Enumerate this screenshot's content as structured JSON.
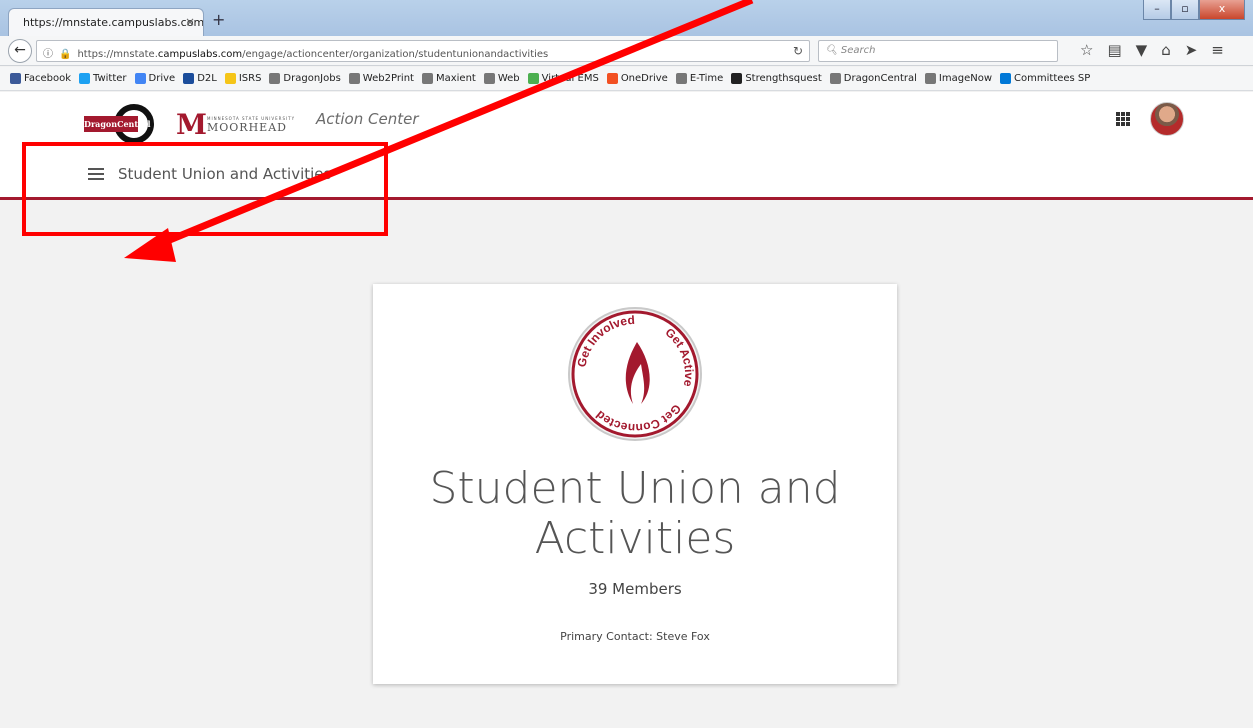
{
  "browser": {
    "tab_title": "https://mnstate.campuslabs.com",
    "tab_close": "×",
    "new_tab": "+",
    "url_prefix": "https://mnstate.",
    "url_host": "campuslabs.com",
    "url_path": "/engage/actioncenter/organization/studentunionandactivities",
    "search_placeholder": "Search",
    "window_buttons": [
      "–",
      "▫",
      "x"
    ]
  },
  "bookmarks": [
    {
      "label": "Facebook",
      "color": "#3b5998"
    },
    {
      "label": "Twitter",
      "color": "#1da1f2"
    },
    {
      "label": "Drive",
      "color": "#4285f4"
    },
    {
      "label": "D2L",
      "color": "#1b4d9b"
    },
    {
      "label": "ISRS",
      "color": "#f5c518"
    },
    {
      "label": "DragonJobs",
      "color": "#777777"
    },
    {
      "label": "Web2Print",
      "color": "#777777"
    },
    {
      "label": "Maxient",
      "color": "#777777"
    },
    {
      "label": "Web",
      "color": "#777777"
    },
    {
      "label": "Virtual EMS",
      "color": "#4caf50"
    },
    {
      "label": "OneDrive",
      "color": "#f25022"
    },
    {
      "label": "E-Time",
      "color": "#777777"
    },
    {
      "label": "Strengthsquest",
      "color": "#222222"
    },
    {
      "label": "DragonCentral",
      "color": "#777777"
    },
    {
      "label": "ImageNow",
      "color": "#777777"
    },
    {
      "label": "Committees SP",
      "color": "#0078d7"
    }
  ],
  "header": {
    "dragon_central_logo": "DragonCentral",
    "msum_small": "MINNESOTA STATE UNIVERSITY",
    "msum_big": "MOORHEAD",
    "app_title": "Action Center",
    "nav_title": "Student Union and Activities"
  },
  "card": {
    "seal_text": [
      "Get Active",
      "Get Connected",
      "Get Involved"
    ],
    "title_line1": "Student Union and",
    "title_line2": "Activities",
    "members": "39 Members",
    "primary_contact": "Primary Contact: Steve Fox"
  },
  "colors": {
    "brand_red": "#a3192e",
    "annotation_red": "#ff0000"
  }
}
